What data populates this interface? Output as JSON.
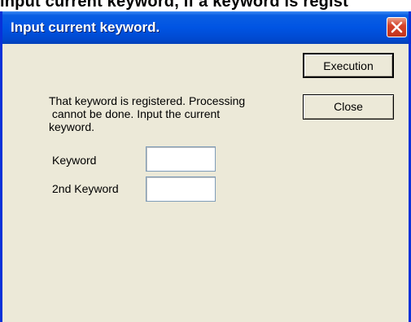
{
  "background_caption": {
    "text": "input current keyword, if a keyword is regist"
  },
  "dialog": {
    "title": "Input current keyword.",
    "close_icon": "close-icon",
    "message": "That keyword is registered. Processing\n cannot be done. Input the current\nkeyword.",
    "buttons": {
      "execution_label": "Execution",
      "close_label": "Close"
    },
    "fields": [
      {
        "label": "Keyword",
        "value": ""
      },
      {
        "label": "2nd Keyword",
        "value": ""
      }
    ],
    "colors": {
      "titlebar": "#0054e3",
      "frame": "#0831d9",
      "body": "#ece9d8",
      "close_button": "#d5432b"
    }
  }
}
